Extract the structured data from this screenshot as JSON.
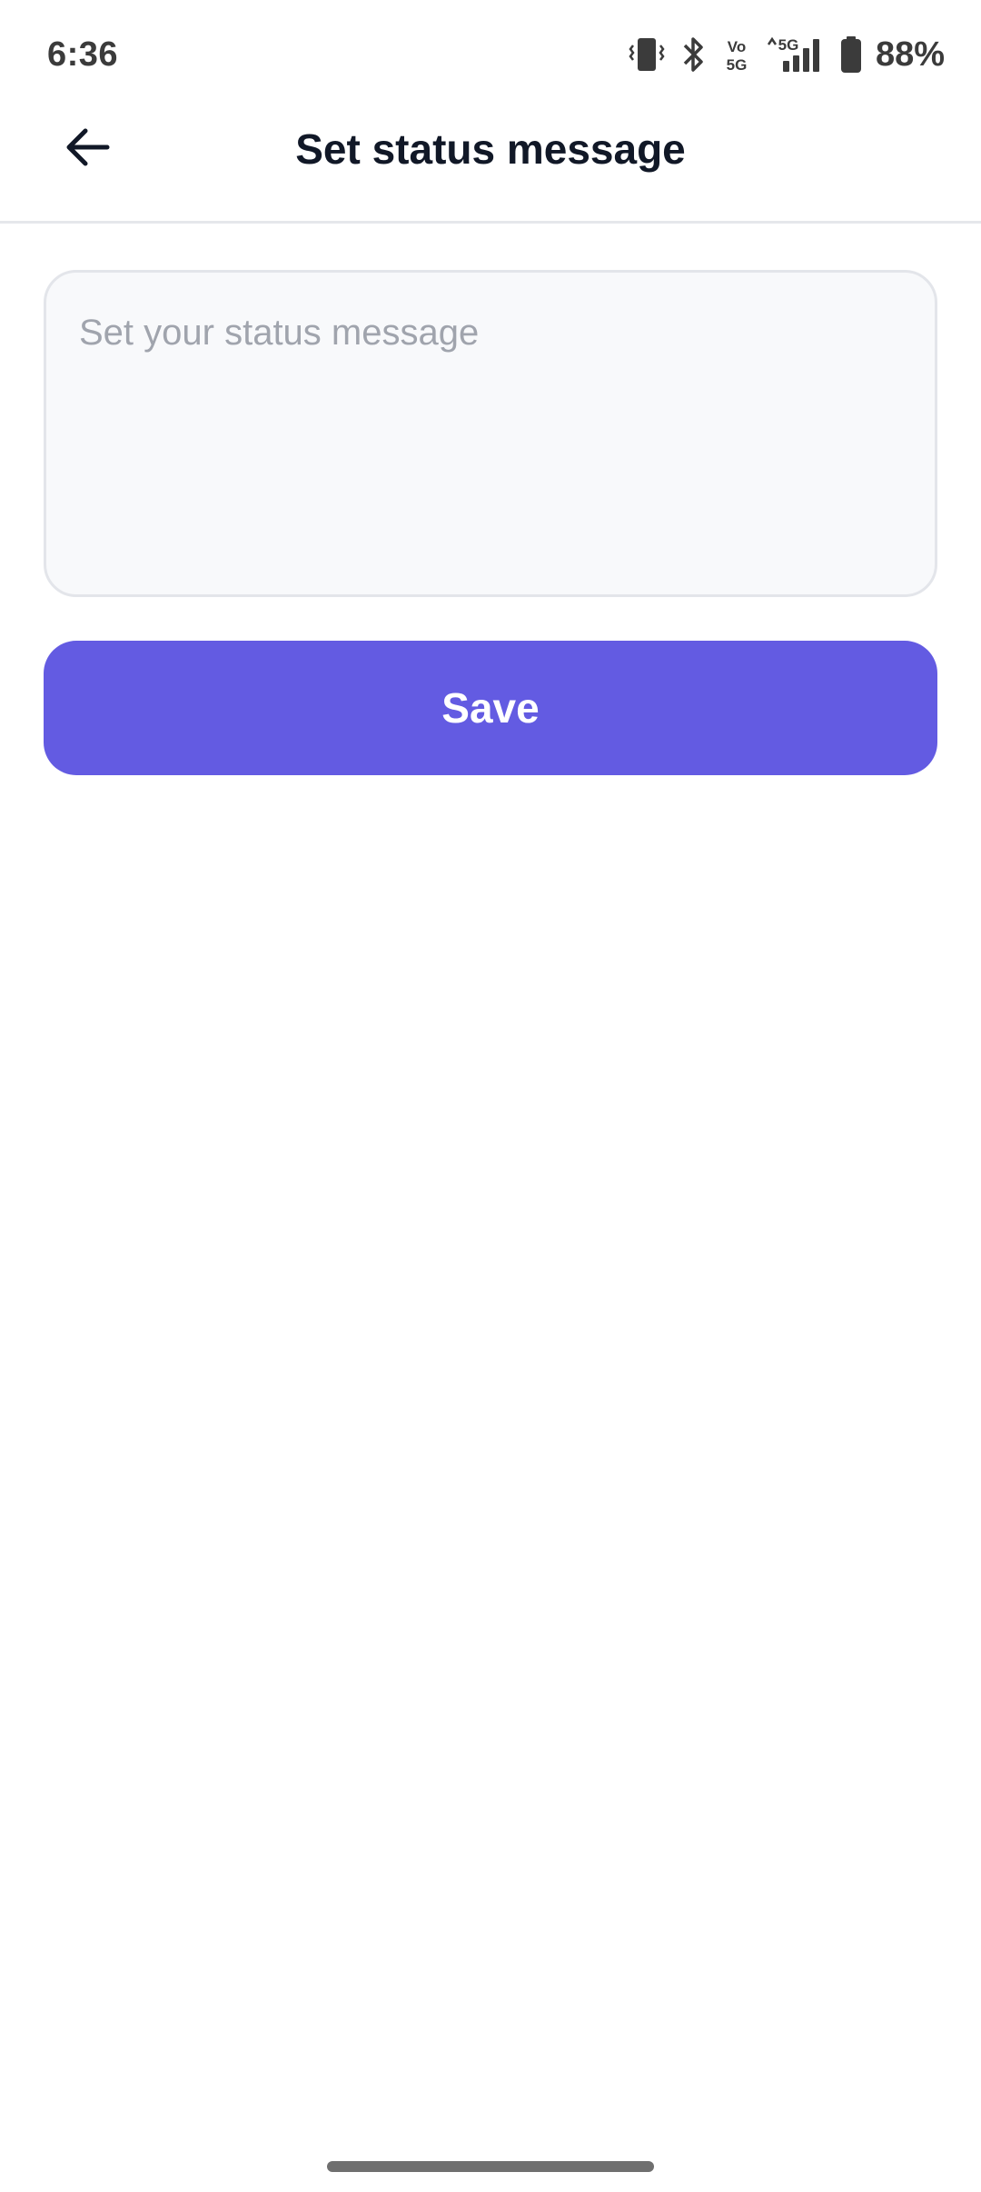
{
  "status_bar": {
    "time": "6:36",
    "battery_percent": "88%",
    "icons": [
      "vibrate-icon",
      "bluetooth-icon",
      "volte-icon",
      "signal-5g-icon",
      "battery-icon"
    ],
    "volte_label_top": "Vo",
    "volte_label_bottom": "5G",
    "network_label": "5G"
  },
  "app_bar": {
    "back_icon": "arrow-left-icon",
    "title": "Set status message"
  },
  "form": {
    "status_input": {
      "value": "",
      "placeholder": "Set your status message"
    },
    "save_label": "Save"
  },
  "colors": {
    "accent": "#635be2",
    "title_text": "#111827",
    "placeholder_text": "#a0a4ad",
    "input_background": "#f8f9fb"
  }
}
